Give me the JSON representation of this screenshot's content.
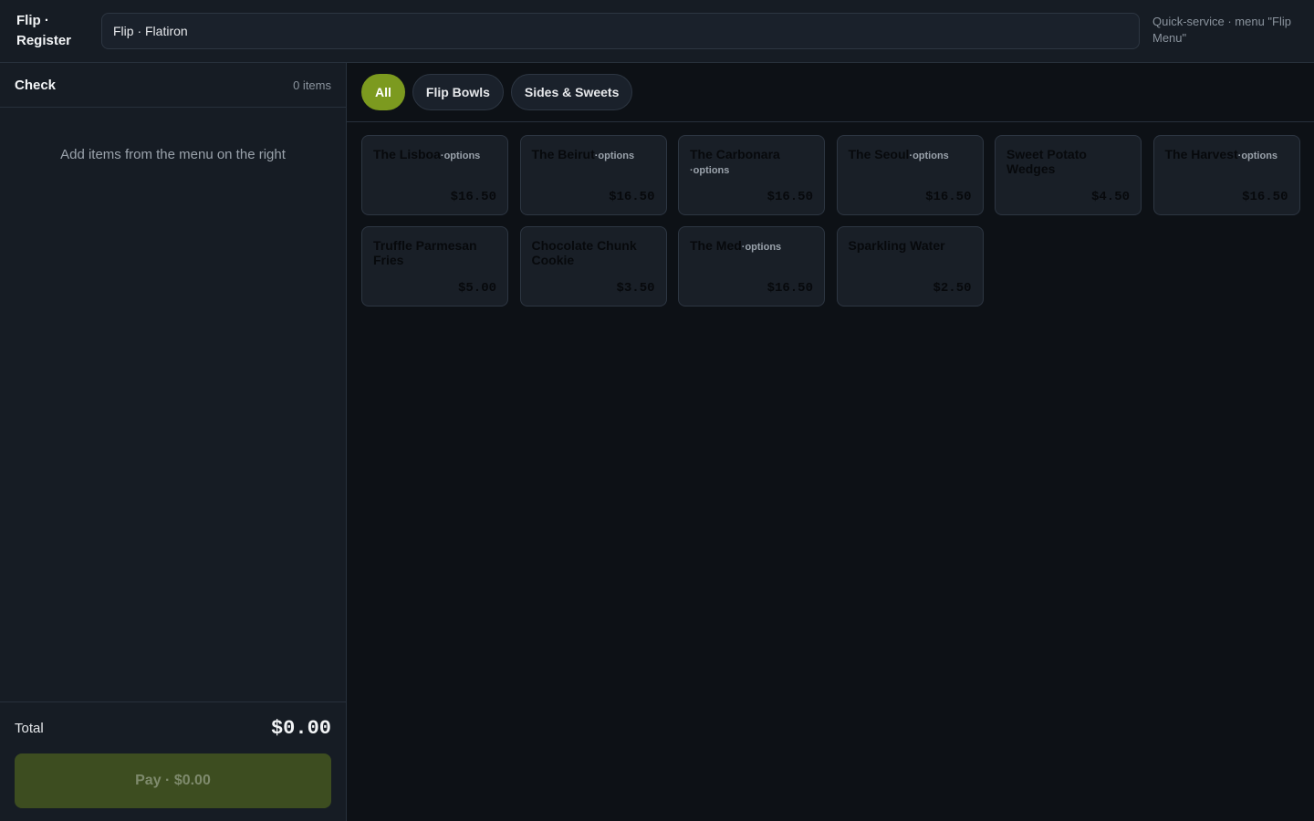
{
  "header": {
    "brand": "Flip · Register",
    "location": "Flip · Flatiron",
    "mode": "Quick-service · menu \"Flip Menu\""
  },
  "check": {
    "title": "Check",
    "count": "0 items",
    "empty": "Add items from the menu on the right",
    "total_label": "Total",
    "total_value": "$0.00",
    "pay_label": "Pay · $0.00"
  },
  "tabs": [
    "All",
    "Flip Bowls",
    "Sides & Sweets"
  ],
  "items": [
    {
      "name": "The Lisboa",
      "options": "·options",
      "price": "$16.50"
    },
    {
      "name": "The Beirut",
      "options": "·options",
      "price": "$16.50"
    },
    {
      "name": "The Carbonara",
      "options": "·options",
      "price": "$16.50"
    },
    {
      "name": "The Seoul",
      "options": "·options",
      "price": "$16.50"
    },
    {
      "name": "Sweet Potato Wedges",
      "options": "",
      "price": "$4.50"
    },
    {
      "name": "The Harvest",
      "options": "·options",
      "price": "$16.50"
    },
    {
      "name": "Truffle Parmesan Fries",
      "options": "",
      "price": "$5.00"
    },
    {
      "name": "Chocolate Chunk Cookie",
      "options": "",
      "price": "$3.50"
    },
    {
      "name": "The Med",
      "options": "·options",
      "price": "$16.50"
    },
    {
      "name": "Sparkling Water",
      "options": "",
      "price": "$2.50"
    }
  ],
  "colors": {
    "accent": "#7c9a1f",
    "pay_disabled": "#3d4d20",
    "panel": "#161c24",
    "background": "#0d1116"
  }
}
